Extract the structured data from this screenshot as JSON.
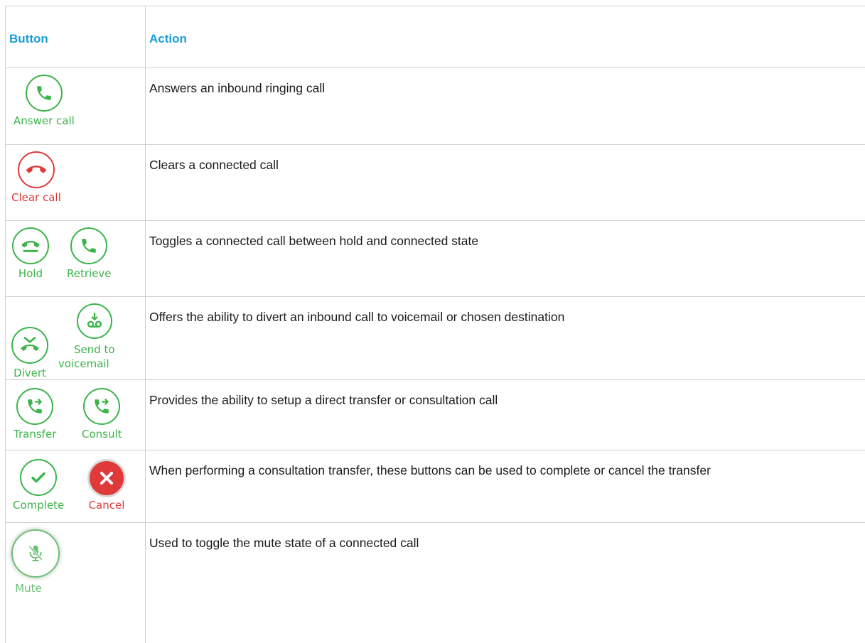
{
  "header": {
    "button": "Button",
    "action": "Action"
  },
  "rows": [
    {
      "labels": [
        "Answer call"
      ],
      "description": "Answers an inbound ringing call"
    },
    {
      "labels": [
        "Clear call"
      ],
      "description": "Clears a connected call"
    },
    {
      "labels": [
        "Hold",
        "Retrieve"
      ],
      "description": "Toggles a connected call between hold and connected state"
    },
    {
      "labels": [
        "Divert",
        "Send to",
        "voicemail"
      ],
      "description": "Offers the ability to divert an inbound call to voicemail or chosen destination"
    },
    {
      "labels": [
        "Transfer",
        "Consult"
      ],
      "description": "Provides the ability to setup a direct transfer or consultation call"
    },
    {
      "labels": [
        "Complete",
        "Cancel"
      ],
      "description": "When performing a consultation transfer, these buttons can be used to complete or cancel the transfer"
    },
    {
      "labels": [
        "Mute"
      ],
      "description": "Used to toggle the mute state of a connected call"
    }
  ],
  "colors": {
    "green": "#3bb449",
    "red": "#e0393a",
    "header_blue": "#1a9bd7"
  },
  "icons": [
    "phone-icon",
    "hang-up-icon",
    "hold-icon",
    "phone-icon",
    "divert-icon",
    "voicemail-icon",
    "transfer-icon",
    "consult-icon",
    "check-icon",
    "cancel-x-icon",
    "mute-icon"
  ]
}
